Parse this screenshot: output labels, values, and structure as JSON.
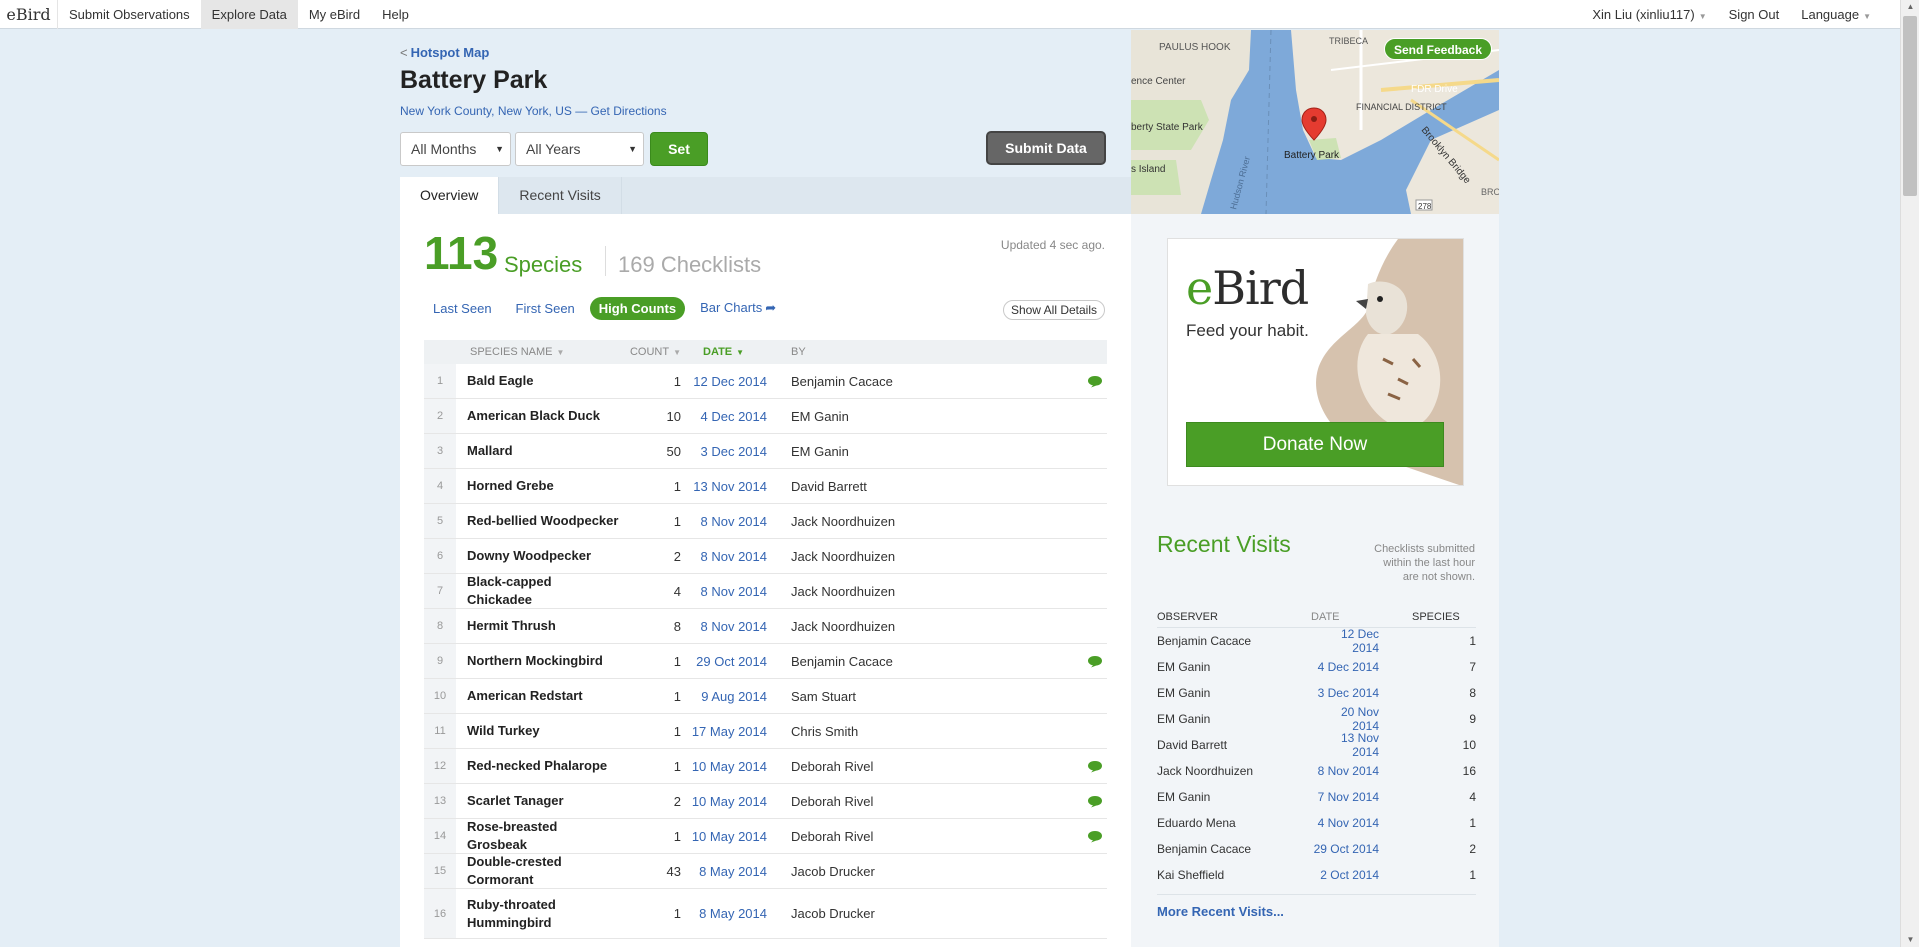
{
  "nav": {
    "logo": "eBird",
    "items": [
      "Submit Observations",
      "Explore Data",
      "My eBird",
      "Help"
    ],
    "user": "Xin Liu (xinliu117)",
    "sign_out": "Sign Out",
    "language": "Language"
  },
  "header": {
    "back_link": "Hotspot Map",
    "title": "Battery Park",
    "location": "New York County, New York, US",
    "directions": "Get Directions"
  },
  "filters": {
    "months": "All Months",
    "years": "All Years",
    "set_label": "Set",
    "submit_label": "Submit Data"
  },
  "tabs": [
    "Overview",
    "Recent Visits"
  ],
  "stats": {
    "species_count": "113",
    "species_label": "Species",
    "checklists": "169 Checklists",
    "updated": "Updated 4 sec ago."
  },
  "subtabs": {
    "last_seen": "Last Seen",
    "first_seen": "First Seen",
    "high_counts": "High Counts",
    "bar_charts": "Bar Charts",
    "show_all": "Show All Details"
  },
  "table": {
    "headers": {
      "name": "Species Name",
      "count": "Count",
      "date": "Date",
      "by": "By"
    },
    "rows": [
      {
        "n": "1",
        "name": "Bald Eagle",
        "count": "1",
        "date": "12 Dec 2014",
        "by": "Benjamin Cacace",
        "comment": true
      },
      {
        "n": "2",
        "name": "American Black Duck",
        "count": "10",
        "date": "4 Dec 2014",
        "by": "EM Ganin",
        "comment": false
      },
      {
        "n": "3",
        "name": "Mallard",
        "count": "50",
        "date": "3 Dec 2014",
        "by": "EM Ganin",
        "comment": false
      },
      {
        "n": "4",
        "name": "Horned Grebe",
        "count": "1",
        "date": "13 Nov 2014",
        "by": "David Barrett",
        "comment": false
      },
      {
        "n": "5",
        "name": "Red-bellied Woodpecker",
        "count": "1",
        "date": "8 Nov 2014",
        "by": "Jack Noordhuizen",
        "comment": false
      },
      {
        "n": "6",
        "name": "Downy Woodpecker",
        "count": "2",
        "date": "8 Nov 2014",
        "by": "Jack Noordhuizen",
        "comment": false
      },
      {
        "n": "7",
        "name": "Black-capped Chickadee",
        "count": "4",
        "date": "8 Nov 2014",
        "by": "Jack Noordhuizen",
        "comment": false
      },
      {
        "n": "8",
        "name": "Hermit Thrush",
        "count": "8",
        "date": "8 Nov 2014",
        "by": "Jack Noordhuizen",
        "comment": false
      },
      {
        "n": "9",
        "name": "Northern Mockingbird",
        "count": "1",
        "date": "29 Oct 2014",
        "by": "Benjamin Cacace",
        "comment": true
      },
      {
        "n": "10",
        "name": "American Redstart",
        "count": "1",
        "date": "9 Aug 2014",
        "by": "Sam Stuart",
        "comment": false
      },
      {
        "n": "11",
        "name": "Wild Turkey",
        "count": "1",
        "date": "17 May 2014",
        "by": "Chris Smith",
        "comment": false
      },
      {
        "n": "12",
        "name": "Red-necked Phalarope",
        "count": "1",
        "date": "10 May 2014",
        "by": "Deborah Rivel",
        "comment": true
      },
      {
        "n": "13",
        "name": "Scarlet Tanager",
        "count": "2",
        "date": "10 May 2014",
        "by": "Deborah Rivel",
        "comment": true
      },
      {
        "n": "14",
        "name": "Rose-breasted Grosbeak",
        "count": "1",
        "date": "10 May 2014",
        "by": "Deborah Rivel",
        "comment": true
      },
      {
        "n": "15",
        "name": "Double-crested Cormorant",
        "count": "43",
        "date": "8 May 2014",
        "by": "Jacob Drucker",
        "comment": false
      },
      {
        "n": "16",
        "name": "Ruby-throated Hummingbird",
        "count": "1",
        "date": "8 May 2014",
        "by": "Jacob Drucker",
        "comment": false
      }
    ]
  },
  "map": {
    "feedback": "Send Feedback",
    "labels": [
      "PAULUS HOOK",
      "TRIBECA",
      "ence Center",
      "FINANCIAL DISTRICT",
      "FDR Drive",
      "berty State Park",
      "Battery Park",
      "Brooklyn Bridge",
      "s Island",
      "Hudson River",
      "278",
      "BRO"
    ]
  },
  "ad": {
    "logo_e": "e",
    "logo_rest": "Bird",
    "tagline": "Feed your habit.",
    "donate": "Donate Now"
  },
  "recent_visits": {
    "title": "Recent Visits",
    "note": "Checklists submitted within the last hour are not shown.",
    "headers": {
      "observer": "Observer",
      "date": "Date",
      "species": "Species"
    },
    "rows": [
      {
        "observer": "Benjamin Cacace",
        "date": "12 Dec 2014",
        "species": "1"
      },
      {
        "observer": "EM Ganin",
        "date": "4 Dec 2014",
        "species": "7"
      },
      {
        "observer": "EM Ganin",
        "date": "3 Dec 2014",
        "species": "8"
      },
      {
        "observer": "EM Ganin",
        "date": "20 Nov 2014",
        "species": "9"
      },
      {
        "observer": "David Barrett",
        "date": "13 Nov 2014",
        "species": "10"
      },
      {
        "observer": "Jack Noordhuizen",
        "date": "8 Nov 2014",
        "species": "16"
      },
      {
        "observer": "EM Ganin",
        "date": "7 Nov 2014",
        "species": "4"
      },
      {
        "observer": "Eduardo Mena",
        "date": "4 Nov 2014",
        "species": "1"
      },
      {
        "observer": "Benjamin Cacace",
        "date": "29 Oct 2014",
        "species": "2"
      },
      {
        "observer": "Kai Sheffield",
        "date": "2 Oct 2014",
        "species": "1"
      }
    ],
    "more": "More Recent Visits..."
  }
}
